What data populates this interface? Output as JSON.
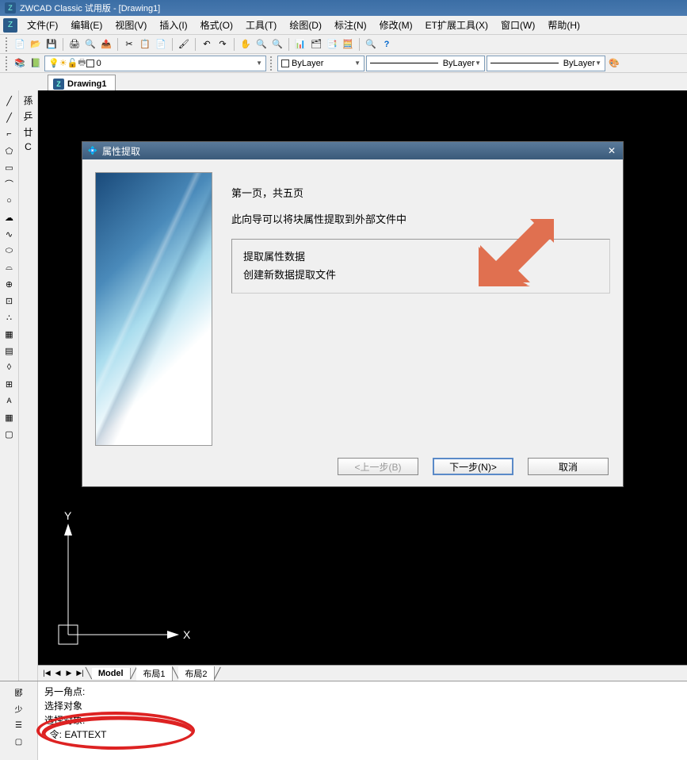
{
  "titlebar": {
    "text": "ZWCAD Classic 试用版 - [Drawing1]"
  },
  "menu": {
    "items": [
      "文件(F)",
      "编辑(E)",
      "视图(V)",
      "插入(I)",
      "格式(O)",
      "工具(T)",
      "绘图(D)",
      "标注(N)",
      "修改(M)",
      "ET扩展工具(X)",
      "窗口(W)",
      "帮助(H)"
    ]
  },
  "toolbar1_icons": [
    "new",
    "open",
    "save",
    "",
    "print",
    "preview",
    "publish",
    "",
    "cut",
    "copy",
    "paste",
    "",
    "match",
    "",
    "undo",
    "redo",
    "",
    "pan",
    "zoom",
    "zoom-win",
    "",
    "props",
    "design",
    "sheet",
    "calc",
    "",
    "zoom-ext",
    "help"
  ],
  "layer_panel": {
    "current": "0",
    "bylayer1": "ByLayer",
    "bylayer2": "ByLayer",
    "bylayer3": "ByLayer"
  },
  "doctab": {
    "name": "Drawing1"
  },
  "left_tools": [
    "line",
    "const",
    "pline",
    "poly",
    "rect",
    "arc",
    "circ",
    "rev",
    "spline",
    "ell",
    "ellarc",
    "block",
    "point",
    "hatch",
    "grad",
    "region",
    "table",
    "mtext"
  ],
  "left_tools2": [
    "孫",
    "乒",
    "廿",
    "C"
  ],
  "layout_tabs": {
    "tabs": [
      "Model",
      "布局1",
      "布局2"
    ]
  },
  "cmd": {
    "line1": "另一角点:",
    "line2": "选择对象",
    "line3": "选择对象:",
    "line4": "令: EATTEXT"
  },
  "dialog": {
    "title": "属性提取",
    "page_label": "第一页，共五页",
    "intro": "此向导可以将块属性提取到外部文件中",
    "opt1": "提取属性数据",
    "opt2": "创建新数据提取文件",
    "btn_prev": "<上一步(B)",
    "btn_next": "下一步(N)>",
    "btn_cancel": "取消"
  }
}
